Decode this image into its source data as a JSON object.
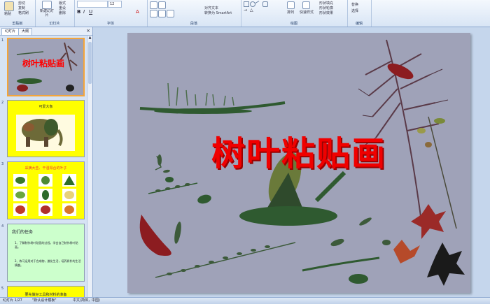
{
  "ribbon": {
    "clipboard": {
      "paste": "粘贴",
      "cut": "剪切",
      "copy": "复制",
      "format_painter": "格式刷",
      "label": "剪贴板"
    },
    "slides": {
      "new_slide": "新建幻灯片",
      "layout": "版式",
      "reset": "重设",
      "delete": "删除",
      "label": "幻灯片"
    },
    "font": {
      "font_size": "12",
      "label": "字体"
    },
    "paragraph": {
      "align_text": "对齐文本",
      "convert_smartart": "转换为 SmartArt",
      "label": "段落"
    },
    "drawing": {
      "arrange": "排列",
      "quick_styles": "快速样式",
      "shape_fill": "形状填充",
      "shape_outline": "形状轮廓",
      "shape_effects": "形状效果",
      "label": "绘图"
    },
    "editing": {
      "replace": "替换",
      "select": "选择",
      "label": "编辑"
    }
  },
  "pane": {
    "tab_slides": "幻灯片",
    "tab_outline": "大纲",
    "close": "×",
    "thumbs": [
      {
        "num": "1",
        "title": "树叶粘贴画"
      },
      {
        "num": "2",
        "title": "可爱大象"
      },
      {
        "num": "3",
        "title": "采摘大些、干湿得合的叶子"
      },
      {
        "num": "4",
        "title": "我们的任务",
        "b1": "1、了解制作树叶贴画的过程，学会自己制作树叶贴画。",
        "b2": "2、练习运用对于合成物，激化生活，培养质朴的生活情趣。"
      },
      {
        "num": "5",
        "title": "要先做好工具和材料的准备"
      }
    ]
  },
  "slide": {
    "title": "树叶粘贴画"
  },
  "status": {
    "slide_info": "幻灯片 1/27",
    "theme": "\"默认设计模板\"",
    "language": "中文(简体，中国)"
  },
  "colors": {
    "title_red": "#f00000",
    "slide_bg": "#9fa2b8",
    "thumb_yellow": "#ffff00",
    "thumb_green": "#ccffcc"
  }
}
